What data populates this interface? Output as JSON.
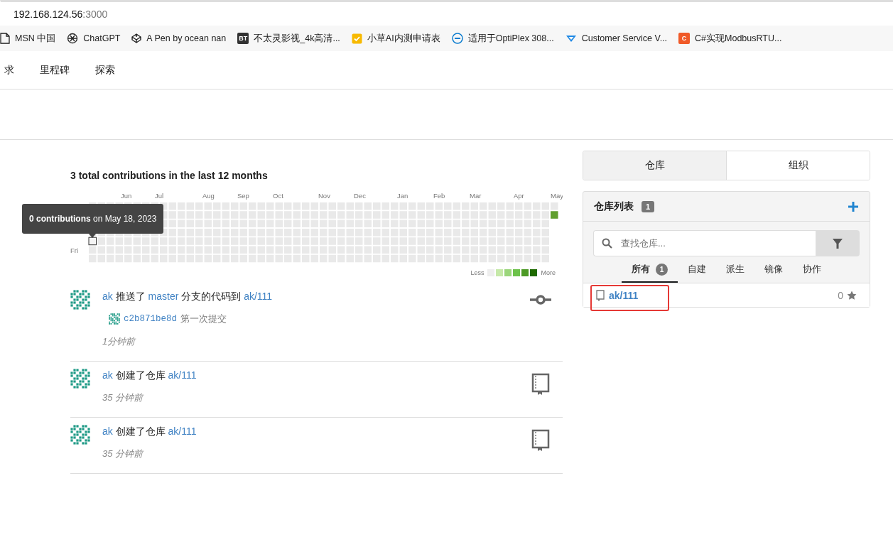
{
  "browser": {
    "address_host": "192.168.124.56",
    "address_port": ":3000",
    "bookmarks": [
      {
        "kind": "page",
        "label": "MSN 中国"
      },
      {
        "kind": "knot",
        "label": "ChatGPT"
      },
      {
        "kind": "cube",
        "label": "A Pen by ocean nan"
      },
      {
        "kind": "badge",
        "badge": "BT",
        "color": "#333333",
        "label": "不太灵影视_4k高清..."
      },
      {
        "kind": "check",
        "label": "小草AI内测申请表"
      },
      {
        "kind": "circle",
        "label": "适用于OptiPlex 308..."
      },
      {
        "kind": "chevron",
        "label": "Customer Service V..."
      },
      {
        "kind": "badge",
        "badge": "C",
        "color": "#f05a28",
        "label": "C#实现ModbusRTU..."
      }
    ]
  },
  "nav": [
    "求",
    "里程碑",
    "探索"
  ],
  "heatmap": {
    "title": "3 total contributions in the last 12 months",
    "months": [
      "Jun",
      "Jul",
      "Aug",
      "Sep",
      "Oct",
      "Nov",
      "Dec",
      "Jan",
      "Feb",
      "Mar",
      "Apr",
      "May"
    ],
    "days": [
      "Fri"
    ],
    "active_cell": {
      "color": "#609f2e"
    },
    "tooltip": {
      "count": "0 contributions",
      "date": "on May 18, 2023"
    },
    "legend_less": "Less",
    "legend_more": "More",
    "legend": [
      {
        "color": "#eeeeee"
      },
      {
        "color": "#c6e9a9"
      },
      {
        "color": "#9bd67b"
      },
      {
        "color": "#6cc24a"
      },
      {
        "color": "#4c9a25"
      },
      {
        "color": "#1e6a00"
      }
    ]
  },
  "feed": [
    {
      "kind": "push",
      "parts": [
        {
          "text": "ak",
          "link": true
        },
        {
          "text": "推送了",
          "link": false
        },
        {
          "text": "master",
          "link": true
        },
        {
          "text": "分支的代码到",
          "link": false
        },
        {
          "text": "ak/111",
          "link": true
        }
      ],
      "commit": {
        "sha": "c2b871be8d",
        "message": "第一次提交"
      },
      "time": "1分钟前"
    },
    {
      "kind": "create",
      "parts": [
        {
          "text": "ak",
          "link": true
        },
        {
          "text": "创建了仓库",
          "link": false
        },
        {
          "text": "ak/111",
          "link": true
        }
      ],
      "time": "35 分钟前"
    },
    {
      "kind": "create",
      "parts": [
        {
          "text": "ak",
          "link": true
        },
        {
          "text": "创建了仓库",
          "link": false
        },
        {
          "text": "ak/111",
          "link": true
        }
      ],
      "time": "35 分钟前"
    }
  ],
  "side_tabs": [
    {
      "label": "仓库",
      "selected": true
    },
    {
      "label": "组织",
      "selected": false
    }
  ],
  "repo_box": {
    "title": "仓库列表",
    "count": "1",
    "search": {
      "placeholder": "查找仓库..."
    },
    "filters": [
      {
        "label": "所有",
        "count": "1",
        "selected": true
      },
      {
        "label": "自建",
        "selected": false
      },
      {
        "label": "派生",
        "selected": false
      },
      {
        "label": "镜像",
        "selected": false
      },
      {
        "label": "协作",
        "selected": false
      }
    ],
    "repos": [
      {
        "name": "ak/111",
        "stars": "0",
        "marked": true
      }
    ]
  }
}
